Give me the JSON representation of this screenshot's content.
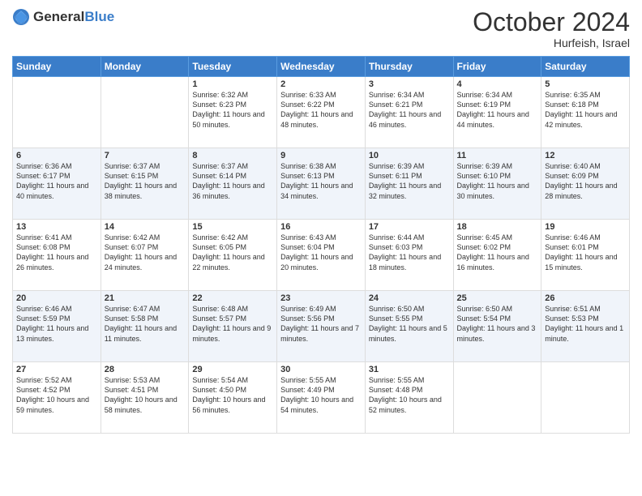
{
  "logo": {
    "general": "General",
    "blue": "Blue"
  },
  "header": {
    "month": "October 2024",
    "location": "Hurfeish, Israel"
  },
  "weekdays": [
    "Sunday",
    "Monday",
    "Tuesday",
    "Wednesday",
    "Thursday",
    "Friday",
    "Saturday"
  ],
  "weeks": [
    [
      {
        "day": "",
        "sunrise": "",
        "sunset": "",
        "daylight": ""
      },
      {
        "day": "",
        "sunrise": "",
        "sunset": "",
        "daylight": ""
      },
      {
        "day": "1",
        "sunrise": "Sunrise: 6:32 AM",
        "sunset": "Sunset: 6:23 PM",
        "daylight": "Daylight: 11 hours and 50 minutes."
      },
      {
        "day": "2",
        "sunrise": "Sunrise: 6:33 AM",
        "sunset": "Sunset: 6:22 PM",
        "daylight": "Daylight: 11 hours and 48 minutes."
      },
      {
        "day": "3",
        "sunrise": "Sunrise: 6:34 AM",
        "sunset": "Sunset: 6:21 PM",
        "daylight": "Daylight: 11 hours and 46 minutes."
      },
      {
        "day": "4",
        "sunrise": "Sunrise: 6:34 AM",
        "sunset": "Sunset: 6:19 PM",
        "daylight": "Daylight: 11 hours and 44 minutes."
      },
      {
        "day": "5",
        "sunrise": "Sunrise: 6:35 AM",
        "sunset": "Sunset: 6:18 PM",
        "daylight": "Daylight: 11 hours and 42 minutes."
      }
    ],
    [
      {
        "day": "6",
        "sunrise": "Sunrise: 6:36 AM",
        "sunset": "Sunset: 6:17 PM",
        "daylight": "Daylight: 11 hours and 40 minutes."
      },
      {
        "day": "7",
        "sunrise": "Sunrise: 6:37 AM",
        "sunset": "Sunset: 6:15 PM",
        "daylight": "Daylight: 11 hours and 38 minutes."
      },
      {
        "day": "8",
        "sunrise": "Sunrise: 6:37 AM",
        "sunset": "Sunset: 6:14 PM",
        "daylight": "Daylight: 11 hours and 36 minutes."
      },
      {
        "day": "9",
        "sunrise": "Sunrise: 6:38 AM",
        "sunset": "Sunset: 6:13 PM",
        "daylight": "Daylight: 11 hours and 34 minutes."
      },
      {
        "day": "10",
        "sunrise": "Sunrise: 6:39 AM",
        "sunset": "Sunset: 6:11 PM",
        "daylight": "Daylight: 11 hours and 32 minutes."
      },
      {
        "day": "11",
        "sunrise": "Sunrise: 6:39 AM",
        "sunset": "Sunset: 6:10 PM",
        "daylight": "Daylight: 11 hours and 30 minutes."
      },
      {
        "day": "12",
        "sunrise": "Sunrise: 6:40 AM",
        "sunset": "Sunset: 6:09 PM",
        "daylight": "Daylight: 11 hours and 28 minutes."
      }
    ],
    [
      {
        "day": "13",
        "sunrise": "Sunrise: 6:41 AM",
        "sunset": "Sunset: 6:08 PM",
        "daylight": "Daylight: 11 hours and 26 minutes."
      },
      {
        "day": "14",
        "sunrise": "Sunrise: 6:42 AM",
        "sunset": "Sunset: 6:07 PM",
        "daylight": "Daylight: 11 hours and 24 minutes."
      },
      {
        "day": "15",
        "sunrise": "Sunrise: 6:42 AM",
        "sunset": "Sunset: 6:05 PM",
        "daylight": "Daylight: 11 hours and 22 minutes."
      },
      {
        "day": "16",
        "sunrise": "Sunrise: 6:43 AM",
        "sunset": "Sunset: 6:04 PM",
        "daylight": "Daylight: 11 hours and 20 minutes."
      },
      {
        "day": "17",
        "sunrise": "Sunrise: 6:44 AM",
        "sunset": "Sunset: 6:03 PM",
        "daylight": "Daylight: 11 hours and 18 minutes."
      },
      {
        "day": "18",
        "sunrise": "Sunrise: 6:45 AM",
        "sunset": "Sunset: 6:02 PM",
        "daylight": "Daylight: 11 hours and 16 minutes."
      },
      {
        "day": "19",
        "sunrise": "Sunrise: 6:46 AM",
        "sunset": "Sunset: 6:01 PM",
        "daylight": "Daylight: 11 hours and 15 minutes."
      }
    ],
    [
      {
        "day": "20",
        "sunrise": "Sunrise: 6:46 AM",
        "sunset": "Sunset: 5:59 PM",
        "daylight": "Daylight: 11 hours and 13 minutes."
      },
      {
        "day": "21",
        "sunrise": "Sunrise: 6:47 AM",
        "sunset": "Sunset: 5:58 PM",
        "daylight": "Daylight: 11 hours and 11 minutes."
      },
      {
        "day": "22",
        "sunrise": "Sunrise: 6:48 AM",
        "sunset": "Sunset: 5:57 PM",
        "daylight": "Daylight: 11 hours and 9 minutes."
      },
      {
        "day": "23",
        "sunrise": "Sunrise: 6:49 AM",
        "sunset": "Sunset: 5:56 PM",
        "daylight": "Daylight: 11 hours and 7 minutes."
      },
      {
        "day": "24",
        "sunrise": "Sunrise: 6:50 AM",
        "sunset": "Sunset: 5:55 PM",
        "daylight": "Daylight: 11 hours and 5 minutes."
      },
      {
        "day": "25",
        "sunrise": "Sunrise: 6:50 AM",
        "sunset": "Sunset: 5:54 PM",
        "daylight": "Daylight: 11 hours and 3 minutes."
      },
      {
        "day": "26",
        "sunrise": "Sunrise: 6:51 AM",
        "sunset": "Sunset: 5:53 PM",
        "daylight": "Daylight: 11 hours and 1 minute."
      }
    ],
    [
      {
        "day": "27",
        "sunrise": "Sunrise: 5:52 AM",
        "sunset": "Sunset: 4:52 PM",
        "daylight": "Daylight: 10 hours and 59 minutes."
      },
      {
        "day": "28",
        "sunrise": "Sunrise: 5:53 AM",
        "sunset": "Sunset: 4:51 PM",
        "daylight": "Daylight: 10 hours and 58 minutes."
      },
      {
        "day": "29",
        "sunrise": "Sunrise: 5:54 AM",
        "sunset": "Sunset: 4:50 PM",
        "daylight": "Daylight: 10 hours and 56 minutes."
      },
      {
        "day": "30",
        "sunrise": "Sunrise: 5:55 AM",
        "sunset": "Sunset: 4:49 PM",
        "daylight": "Daylight: 10 hours and 54 minutes."
      },
      {
        "day": "31",
        "sunrise": "Sunrise: 5:55 AM",
        "sunset": "Sunset: 4:48 PM",
        "daylight": "Daylight: 10 hours and 52 minutes."
      },
      {
        "day": "",
        "sunrise": "",
        "sunset": "",
        "daylight": ""
      },
      {
        "day": "",
        "sunrise": "",
        "sunset": "",
        "daylight": ""
      }
    ]
  ]
}
